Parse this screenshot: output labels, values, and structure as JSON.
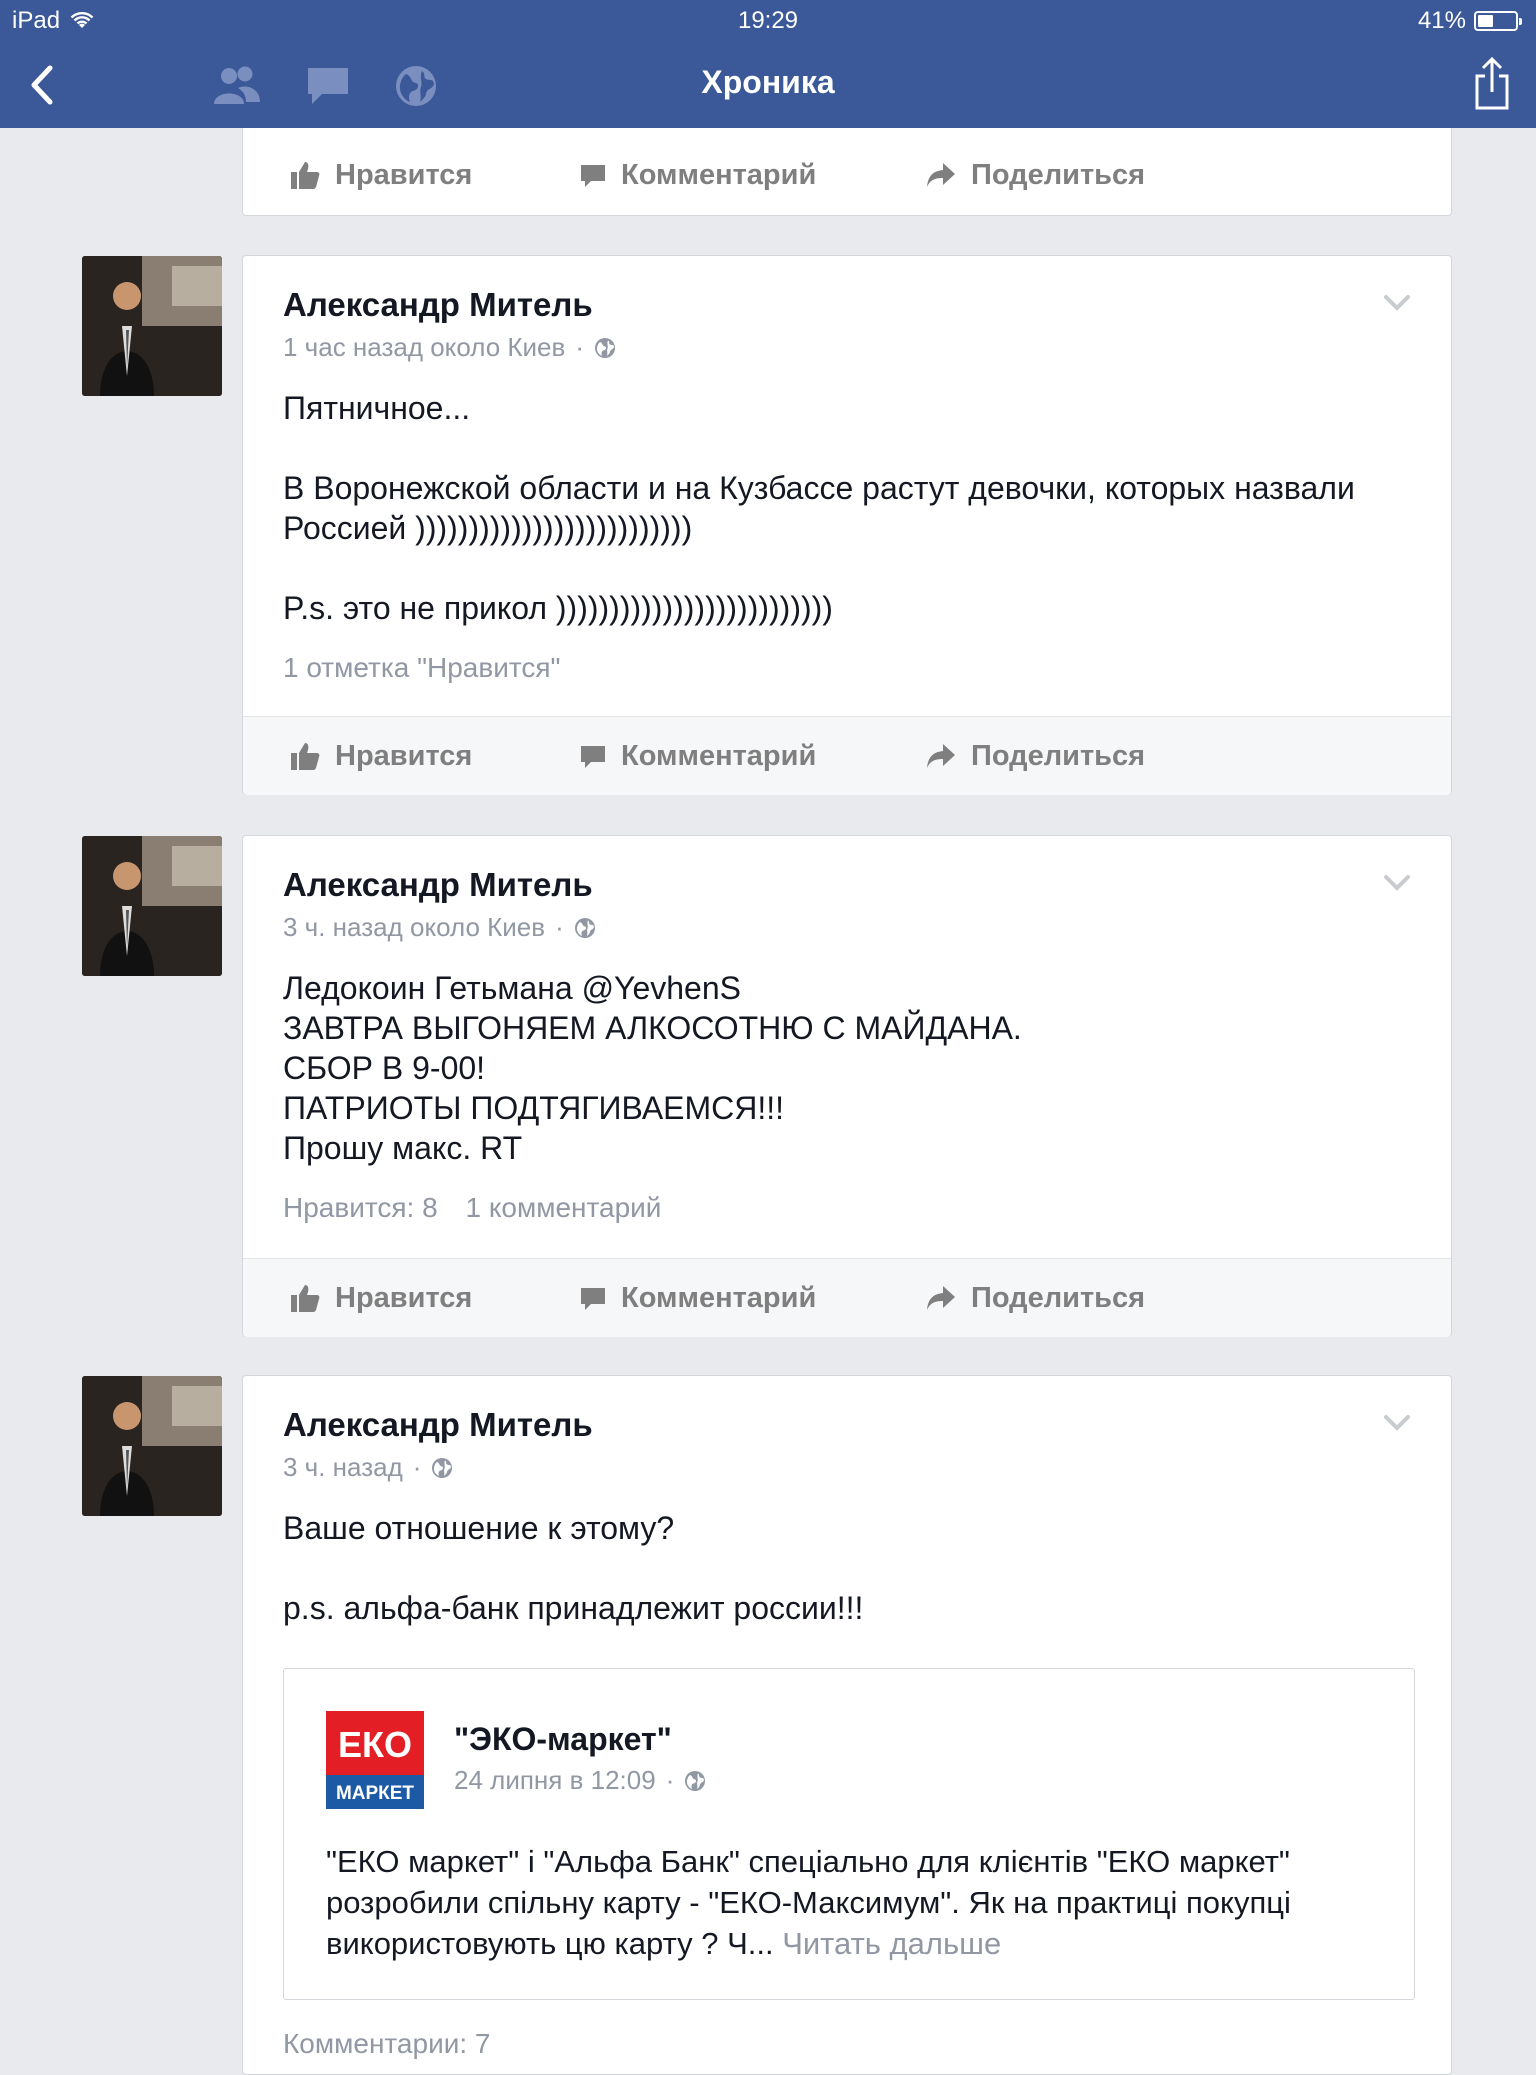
{
  "status_bar": {
    "device": "iPad",
    "time": "19:29",
    "battery": "41%",
    "battery_level": 0.41
  },
  "nav": {
    "title": "Хроника"
  },
  "actions": {
    "like": "Нравится",
    "comment": "Комментарий",
    "share": "Поделиться"
  },
  "posts": [
    {
      "author": "Александр Митель",
      "meta": "1 час назад около Киев",
      "text": "Пятничное...\n\nВ Воронежской области и на Кузбассе растут девочки, которых назвали Россией ))))))))))))))))))))))))))\n\nP.s. это не прикол ))))))))))))))))))))))))))",
      "likes_text": "1 отметка \"Нравится\""
    },
    {
      "author": "Александр Митель",
      "meta": "3 ч. назад около Киев",
      "text": "Ледокоин Гетьмана @YevhenS\nЗАВТРА ВЫГОНЯЕМ АЛКОСОТНЮ С МАЙДАНА.\nСБОР В 9-00!\nПАТРИОТЫ ПОДТЯГИВАЕМСЯ!!!\nПрошу макс. RT",
      "likes_text": "Нравится: 8",
      "comments_text": "1 комментарий"
    },
    {
      "author": "Александр Митель",
      "meta": "3 ч. назад",
      "text": "Ваше отношение к этому?\n\np.s. альфа-банк принадлежит россии!!!",
      "shared": {
        "logo_top": "ЕКО",
        "logo_bottom": "МАРКЕТ",
        "author": "\"ЭКО-маркет\"",
        "meta": "24 липня в 12:09",
        "text": "\"ЕКО маркет\" і \"Альфа Банк\" спеціально для клієнтів \"ЕКО маркет\" розробили спільну карту - \"ЕКО-Максимум\". Як на практиці покупці використовують цю карту ? Ч...",
        "read_more": "Читать дальше"
      },
      "comments_text": "Комментарии: 7"
    }
  ]
}
